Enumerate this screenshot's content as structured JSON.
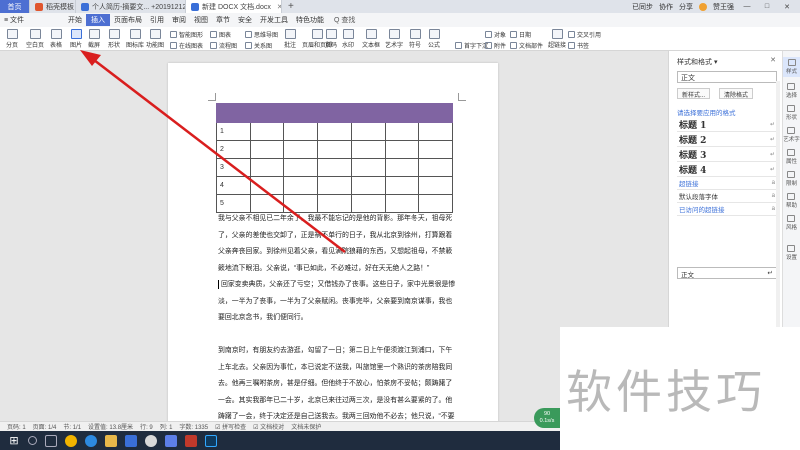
{
  "titlebar": {
    "home_tab": "首页",
    "tabs": [
      {
        "label": "稻壳模板",
        "color": "#e0562e",
        "active": false
      },
      {
        "label": "个人简历-摘要文... +20191212",
        "color": "#3a6fd8",
        "active": false
      },
      {
        "label": "新建 DOCX 文档.docx",
        "color": "#3a6fd8",
        "active": true
      }
    ],
    "new_tab": "+",
    "sync": "已同步",
    "collab": "协作",
    "share": "分享",
    "user": "赞王强",
    "window_buttons": [
      "—",
      "□",
      "✕"
    ]
  },
  "menubar": {
    "items": [
      "≡ 文件",
      "开始",
      "插入",
      "页面布局",
      "引用",
      "审阅",
      "视图",
      "章节",
      "安全",
      "开发工具",
      "特色功能"
    ],
    "active": "插入",
    "search": "Q 查找",
    "right_items": [
      "未同步",
      "协作",
      "分享"
    ]
  },
  "ribbon": {
    "big_buttons": [
      "分页",
      "空白页",
      "表格",
      "图片",
      "截屏",
      "形状",
      "图标库",
      "功能图"
    ],
    "highlight": "图片",
    "small": {
      "smart_graphic": "智能图形",
      "online_chart": "在线图表",
      "chart": "图表",
      "flow_chart": "流程图",
      "relationship": "关系图",
      "mind_map": "思维导图",
      "comment": "批注",
      "header_footer": "页眉和页脚",
      "page_number": "页码",
      "watermark": "水印",
      "text_box": "文本框",
      "art_text": "艺术字",
      "symbol": "符号",
      "formula": "公式",
      "drop_cap": "首字下沉",
      "attachment": "附件",
      "object": "对象",
      "date": "日期",
      "doc_parts": "文档部件",
      "hyperlink": "超链接",
      "cross_ref": "交叉引用",
      "bookmark": "书签"
    }
  },
  "document": {
    "table": {
      "rows": [
        "1",
        "2",
        "3",
        "4",
        "5"
      ],
      "header_color": "#8064a2",
      "columns": 7
    },
    "paragraphs": [
      "我与父亲不相见已二年余了，我最不能忘记的是他的背影。那年冬天，祖母死了，父亲的差使也交卸了，正是祸不单行的日子，我从北京到徐州，打算跟着父亲奔丧回家。到徐州见着父亲，看见满院狼藉的东西，又想起祖母，不禁簌簌地流下眼泪。父亲说，“事已如此，不必难过，好在天无绝人之路！”",
      "回家变卖典质，父亲还了亏空；又借钱办了丧事。这些日子，家中光景很是惨淡，一半为了丧事，一半为了父亲赋闲。丧事完毕，父亲要到南京谋事，我也要回北京念书，我们便同行。",
      "到南京时，有朋友约去游逛，勾留了一日；第二日上午便须渡江到浦口，下午上车北去。父亲因为事忙，本已说定不送我，叫旅馆里一个熟识的茶房陪我同去。他再三嘱咐茶房，甚是仔细。但他终于不放心，怕茶房不妥帖；颇踌躇了一会。其实我那年已二十岁，北京已来往过两三次，是没有甚么要紧的了。他踌躇了一会，终于决定还是自己送我去。我两三回劝他不必去；他只说，“不要紧，"
    ]
  },
  "style_pane": {
    "title": "样式和格式 ▾",
    "close": "✕",
    "current": "正文",
    "new_style": "新样式...",
    "clear_format": "清除格式",
    "hint": "请选择要应用的格式",
    "headings": [
      {
        "label": "标题 1",
        "mark": "↵"
      },
      {
        "label": "标题 2",
        "mark": "↵"
      },
      {
        "label": "标题 3",
        "mark": "↵"
      },
      {
        "label": "标题 4",
        "mark": "↵"
      }
    ],
    "others": [
      {
        "label": "超链接",
        "mark": "a",
        "link": true
      },
      {
        "label": "默认段落字体",
        "mark": "a",
        "link": false
      },
      {
        "label": "已访问的超链接",
        "mark": "a",
        "link": true
      }
    ],
    "bottom": "正文",
    "bottom_mark": "↵"
  },
  "sidetools": [
    "样式",
    "选择",
    "形状",
    "艺术字",
    "属性",
    "限制",
    "帮助",
    "风格",
    "设置"
  ],
  "statusbar": {
    "page": "页码: 1",
    "pages": "页面: 1/4",
    "section": "节: 1/1",
    "line": "设置值: 13.8厘米",
    "row": "行: 9",
    "col": "列: 1",
    "words": "字数: 1335",
    "spell": "☑ 拼写检查",
    "doc_check": "☑ 文档校对",
    "protect": "文档未保护"
  },
  "watermark": {
    "text": "软件技巧",
    "badge_line1": "90",
    "badge_line2": "0.1s/s"
  }
}
